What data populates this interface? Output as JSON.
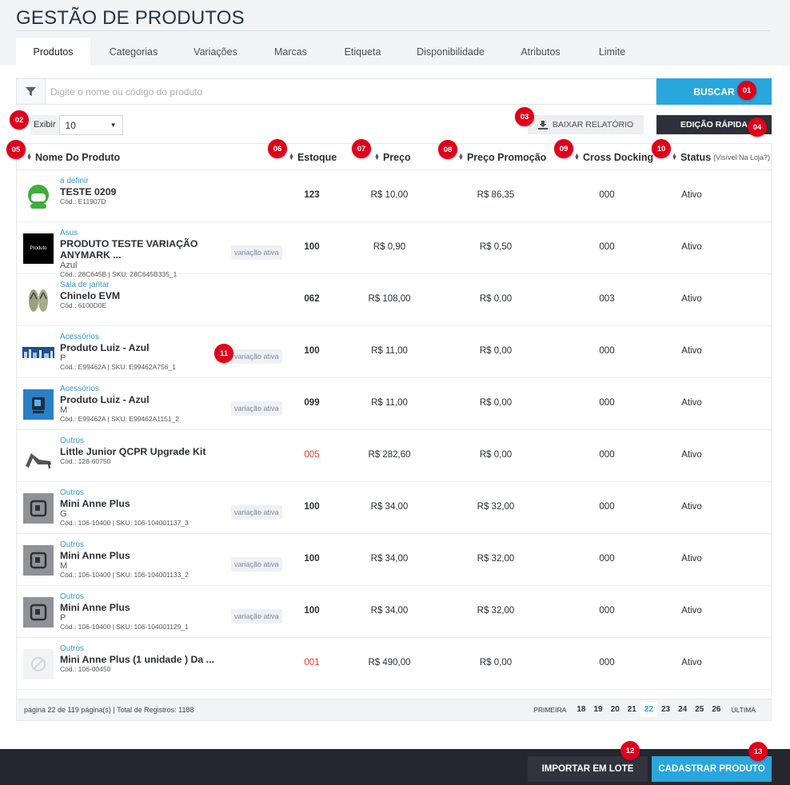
{
  "page": {
    "title": "GESTÃO DE PRODUTOS"
  },
  "tabs": [
    {
      "label": "Produtos",
      "active": true
    },
    {
      "label": "Categorias"
    },
    {
      "label": "Variações"
    },
    {
      "label": "Marcas"
    },
    {
      "label": "Etiqueta"
    },
    {
      "label": "Disponibilidade"
    },
    {
      "label": "Atributos"
    },
    {
      "label": "Limite"
    }
  ],
  "search": {
    "placeholder": "Digite o nome ou código do produto",
    "button": "BUSCAR",
    "filter_icon": "funnel-icon"
  },
  "toolbar": {
    "exibir_label": "Exibir",
    "exibir_value": "10",
    "report_button": "BAIXAR RELATÓRIO",
    "report_icon": "download-icon",
    "quick_edit_button": "EDIÇÃO RÁPIDA"
  },
  "table": {
    "headers": {
      "name": "Nome Do Produto",
      "stock": "Estoque",
      "price": "Preço",
      "promo": "Preço Promoção",
      "cross": "Cross Docking",
      "status": "Status",
      "status_note": "(Visível Na Loja?)"
    },
    "rows": [
      {
        "thumb": "green-helmet",
        "category": "a definir",
        "name": "TESTE 0209",
        "variant": "",
        "code": "Cód.: E11907D",
        "badge": "",
        "stock": "123",
        "stock_red": false,
        "price": "R$ 10,00",
        "promo": "R$ 86,35",
        "cross": "000",
        "status": "Ativo"
      },
      {
        "thumb": "black-product",
        "thumb_text": "Produto",
        "category": "Asus",
        "name": "PRODUTO TESTE VARIAÇÃO ANYMARK ...",
        "variant": "Azul",
        "code": "Cód.: 28C645B | SKU: 28C645B335_1",
        "badge": "variação ativa",
        "stock": "100",
        "stock_red": false,
        "price": "R$ 0,90",
        "promo": "R$ 0,50",
        "cross": "000",
        "status": "Ativo"
      },
      {
        "thumb": "flip-flops",
        "category": "Sala de jantar",
        "name": "Chinelo EVM",
        "variant": "",
        "code": "Cód.: 6100D0E",
        "badge": "",
        "stock": "062",
        "stock_red": false,
        "price": "R$ 108,00",
        "promo": "R$ 0,00",
        "cross": "003",
        "status": "Ativo"
      },
      {
        "thumb": "city-banner",
        "category": "Acessórios",
        "name": "Produto Luiz - Azul",
        "variant": "P",
        "code": "Cód.: E99462A | SKU: E99462A756_1",
        "badge": "variação ativa",
        "stock": "100",
        "stock_red": false,
        "price": "R$ 11,00",
        "promo": "R$ 0,00",
        "cross": "000",
        "status": "Ativo"
      },
      {
        "thumb": "blue-device",
        "category": "Acessórios",
        "name": "Produto Luiz - Azul",
        "variant": "M",
        "code": "Cód.: E99462A | SKU: E99462A1151_2",
        "badge": "variação ativa",
        "stock": "099",
        "stock_red": false,
        "price": "R$ 11,00",
        "promo": "R$ 0,00",
        "cross": "000",
        "status": "Ativo"
      },
      {
        "thumb": "high-heel",
        "category": "Outros",
        "name": "Little Junior QCPR Upgrade Kit",
        "variant": "",
        "code": "Cód.: 128-60750",
        "badge": "",
        "stock": "005",
        "stock_red": true,
        "price": "R$ 282,60",
        "promo": "R$ 0,00",
        "cross": "000",
        "status": "Ativo"
      },
      {
        "thumb": "grey-logo",
        "category": "Outros",
        "name": "Mini Anne Plus",
        "variant": "G",
        "code": "Cód.: 106-10400 | SKU: 106-104001137_3",
        "badge": "variação ativa",
        "stock": "100",
        "stock_red": false,
        "price": "R$ 34,00",
        "promo": "R$ 32,00",
        "cross": "000",
        "status": "Ativo"
      },
      {
        "thumb": "grey-logo",
        "category": "Outros",
        "name": "Mini Anne Plus",
        "variant": "M",
        "code": "Cód.: 106-10400 | SKU: 106-104001133_2",
        "badge": "variação ativa",
        "stock": "100",
        "stock_red": false,
        "price": "R$ 34,00",
        "promo": "R$ 32,00",
        "cross": "000",
        "status": "Ativo"
      },
      {
        "thumb": "grey-logo",
        "category": "Outros",
        "name": "Mini Anne Plus",
        "variant": "P",
        "code": "Cód.: 106-10400 | SKU: 106-104001129_1",
        "badge": "variação ativa",
        "stock": "100",
        "stock_red": false,
        "price": "R$ 34,00",
        "promo": "R$ 32,00",
        "cross": "000",
        "status": "Ativo"
      },
      {
        "thumb": "no-image",
        "category": "Outros",
        "name": "Mini Anne Plus (1 unidade ) Da ...",
        "variant": "",
        "code": "Cód.: 106-00450",
        "badge": "",
        "stock": "001",
        "stock_red": true,
        "price": "R$ 490,00",
        "promo": "R$ 0,00",
        "cross": "000",
        "status": "Ativo"
      }
    ],
    "footer": {
      "page_info": "página 22 de 119 página(s) | Total de Registros: 1188",
      "first": "PRIMEIRA",
      "last": "ÚLTIMA",
      "pages": [
        "18",
        "19",
        "20",
        "21",
        "22",
        "23",
        "24",
        "25",
        "26"
      ],
      "current": "22"
    }
  },
  "footer_actions": {
    "import": "IMPORTAR EM LOTE",
    "add": "CADASTRAR PRODUTO"
  },
  "markers": [
    "01",
    "02",
    "03",
    "04",
    "05",
    "06",
    "07",
    "08",
    "09",
    "10",
    "11",
    "12",
    "13"
  ],
  "colors": {
    "accent": "#29a6dd",
    "dark": "#2d3038",
    "marker": "#e0001b",
    "link": "#3597d3",
    "stock_low": "#e23a32"
  }
}
